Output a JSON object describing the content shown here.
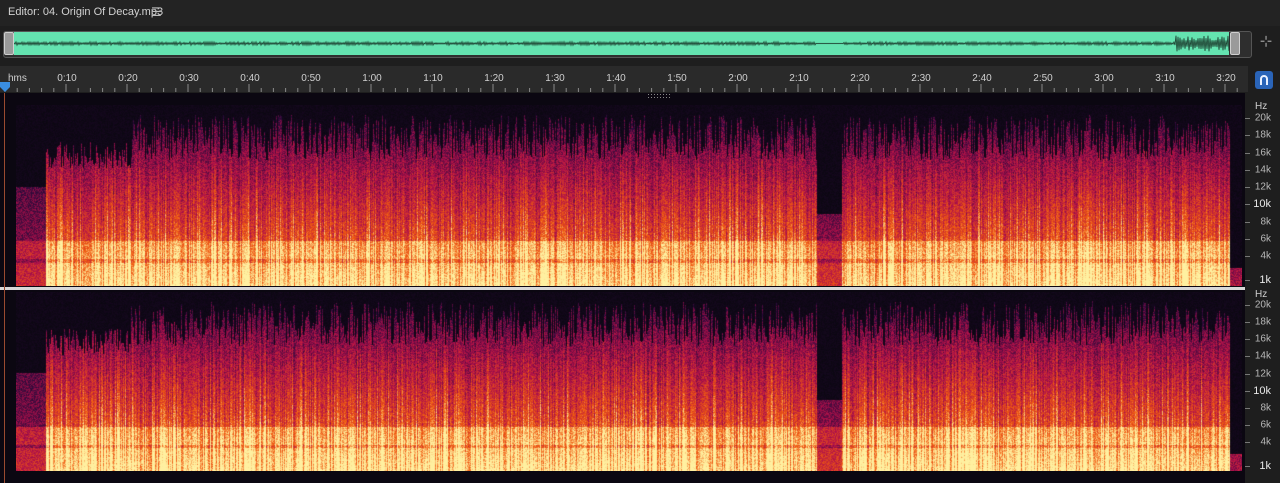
{
  "editor": {
    "title": "Editor: 04. Origin Of Decay.mp3",
    "menu_icon": "hamburger-menu-icon"
  },
  "overview": {
    "waveform_color": "#64e3b0"
  },
  "ruler": {
    "unit_label": "hms",
    "ticks": [
      "0:10",
      "0:20",
      "0:30",
      "0:40",
      "0:50",
      "1:00",
      "1:10",
      "1:20",
      "1:30",
      "1:40",
      "1:50",
      "2:00",
      "2:10",
      "2:20",
      "2:30",
      "2:40",
      "2:50",
      "3:00",
      "3:10",
      "3:20"
    ]
  },
  "frequency_scale": {
    "unit": "Hz",
    "labels": [
      "20k",
      "18k",
      "16k",
      "14k",
      "12k",
      "10k",
      "8k",
      "6k",
      "4k",
      "1k"
    ],
    "major": [
      "10k",
      "1k"
    ]
  },
  "spectral": {
    "channels": 2,
    "colors": {
      "background": "#0b0711",
      "low": "#2a0a3a",
      "mid": "#b0104a",
      "high": "#f05a10",
      "peak": "#fff0a0"
    }
  },
  "icons": {
    "zoom": "zoom-navigator-icon",
    "snap": "snap-magnet-icon",
    "playhead": "playhead-marker-icon"
  }
}
